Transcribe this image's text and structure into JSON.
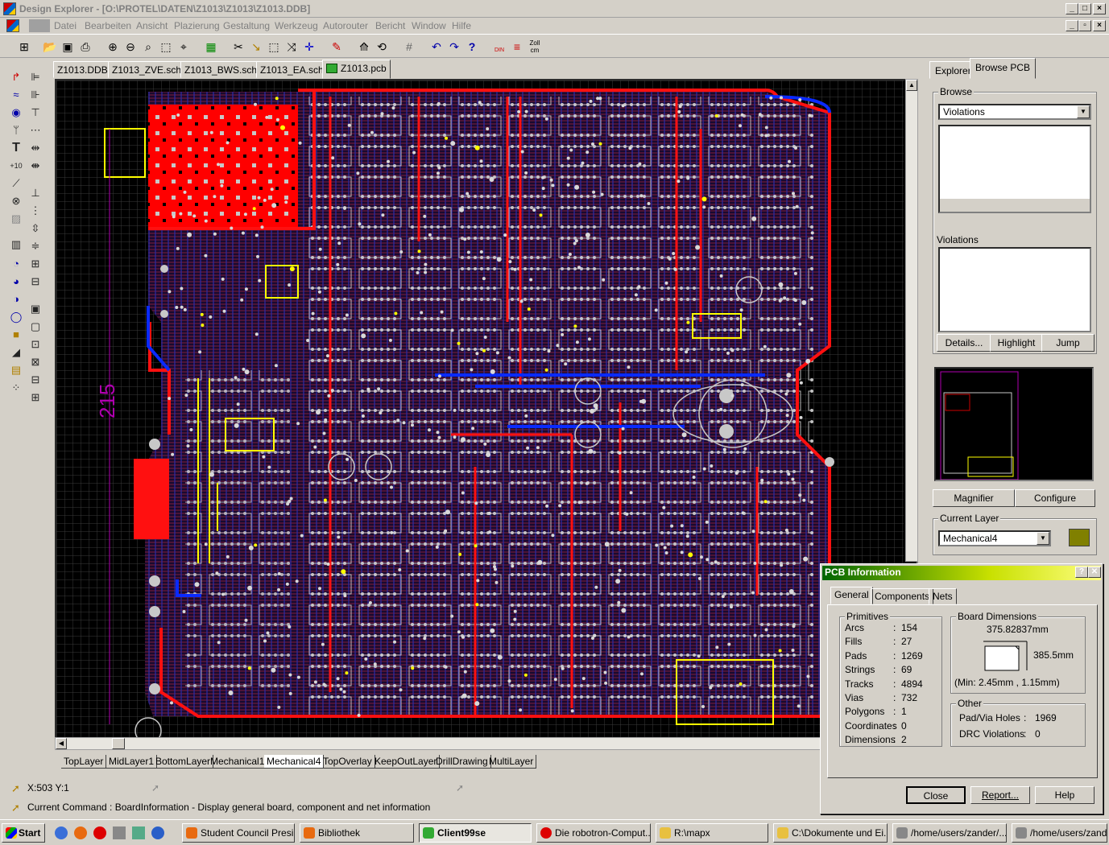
{
  "window": {
    "title": "Design Explorer - [O:\\PROTEL\\DATEN\\Z1013\\Z1013\\Z1013.DDB]"
  },
  "menu": [
    "Datei",
    "Bearbeiten",
    "Ansicht",
    "Plazierung",
    "Gestaltung",
    "Werkzeug",
    "Autorouter",
    "Bericht",
    "Window",
    "Hilfe"
  ],
  "toolbar": {
    "unit_label_1": "Zoll",
    "unit_label_2": "cm",
    "din_label": "DIN"
  },
  "doc_tabs": [
    "Z1013.DDB",
    "Z1013_ZVE.sch",
    "Z1013_BWS.sch",
    "Z1013_EA.sch",
    "Z1013.pcb"
  ],
  "canvas": {
    "dimension_label": "215"
  },
  "layer_tabs": [
    "TopLayer",
    "MidLayer1",
    "BottomLayer",
    "Mechanical1",
    "Mechanical4",
    "TopOverlay",
    "KeepOutLayer",
    "DrillDrawing",
    "MultiLayer"
  ],
  "status": {
    "coords": "X:503 Y:1",
    "command": "Current Command : BoardInformation - Display general board, component and net information"
  },
  "right_panel": {
    "tabs": [
      "Explorer",
      "Browse PCB"
    ],
    "browse_label": "Browse",
    "browse_value": "Violations",
    "violations_label": "Violations",
    "buttons": [
      "Details...",
      "Highlight",
      "Jump"
    ],
    "magnifier": "Magnifier",
    "configure": "Configure",
    "current_layer_label": "Current Layer",
    "current_layer_value": "Mechanical4",
    "layer_color": "#808000"
  },
  "dialog": {
    "title": "PCB Information",
    "help_btn": "?",
    "close_x": "✕",
    "tabs": [
      "General",
      "Components",
      "Nets"
    ],
    "primitives_label": "Primitives",
    "primitives": [
      {
        "name": "Arcs",
        "value": "154"
      },
      {
        "name": "Fills",
        "value": "27"
      },
      {
        "name": "Pads",
        "value": "1269"
      },
      {
        "name": "Strings",
        "value": "69"
      },
      {
        "name": "Tracks",
        "value": "4894"
      },
      {
        "name": "Vias",
        "value": "732"
      },
      {
        "name": "Polygons",
        "value": "1"
      },
      {
        "name": "Coordinates",
        "value": "0"
      },
      {
        "name": "Dimensions",
        "value": "2"
      }
    ],
    "board_dim_label": "Board Dimensions",
    "board_width": "375.82837mm",
    "board_height": "385.5mm",
    "board_min": "(Min: 2.45mm , 1.15mm)",
    "other_label": "Other",
    "padvia_label": "Pad/Via Holes",
    "padvia_value": "1969",
    "drc_label": "DRC Violations",
    "drc_value": "0",
    "btn_close": "Close",
    "btn_report": "Report...",
    "btn_help": "Help"
  },
  "taskbar": {
    "start": "Start",
    "tasks": [
      "Student Council Presi...",
      "Bibliothek",
      "Client99se",
      "Die robotron-Comput...",
      "R:\\mapx",
      "C:\\Dokumente und Ei...",
      "/home/users/zander/....",
      "/home/users/zander..."
    ]
  }
}
